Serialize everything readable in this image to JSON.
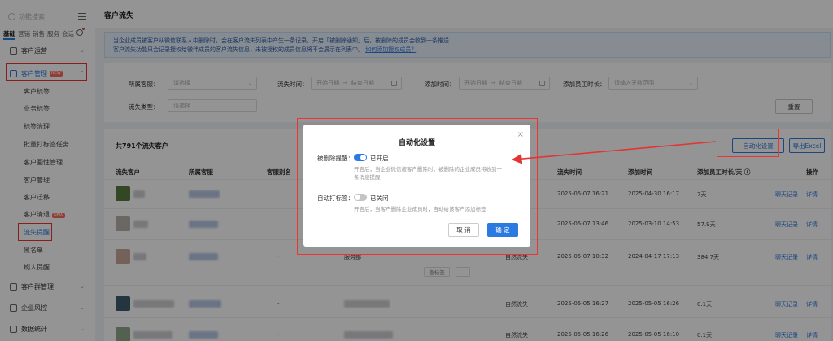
{
  "sidebar": {
    "search_placeholder": "功能搜索",
    "tabs": [
      "基础",
      "营销",
      "销售",
      "服务",
      "会话"
    ],
    "groups": [
      {
        "label": "客户运营"
      },
      {
        "label": "客户管理",
        "badge": "NEW"
      },
      {
        "label": "客户群管理"
      },
      {
        "label": "企业风控"
      },
      {
        "label": "数据统计"
      }
    ],
    "sub_items": [
      "客户标签",
      "业务标签",
      "标签治理",
      "批量打标签任务",
      "客户画性管理",
      "客户管理",
      "客户迁移",
      "客户清退",
      "流失提醒",
      "黑名单",
      "刷人提醒"
    ],
    "sub_badge": "NEW"
  },
  "page": {
    "title": "客户流失",
    "notice_line1": "当企业成员被客户从微信联系人中删除时，会在客户流失列表中产生一条记录。开启「被删除通知」后，被删除的成员会收到一条推送",
    "notice_line2": "客户流失功能只会记录授权给微伴成员的客户流失信息，未被授权的成员信息将不会展示在列表中。",
    "notice_link": "如何添加授权成员？"
  },
  "filters": {
    "owner_label": "所属客服：",
    "owner_placeholder": "请选择",
    "lost_time_label": "流失时间：",
    "lost_start": "开始日期",
    "lost_end": "结束日期",
    "add_time_label": "添加时间：",
    "add_start": "开始日期",
    "add_end": "结束日期",
    "duration_label": "添加员工时长：",
    "duration_placeholder": "请输入天数范围",
    "type_label": "流失类型：",
    "type_placeholder": "请选择",
    "reset": "重置",
    "arrow": "→"
  },
  "table": {
    "total": "共791个流失客户",
    "btn_auto": "自动化设置",
    "btn_export": "导出Excel",
    "headers": [
      "流失客户",
      "所属客服",
      "客服别名",
      "流失时间",
      "添加时间",
      "添加员工时长/天 ⓘ",
      "操作"
    ],
    "rows": [
      {
        "alias": "-",
        "lost": "2025-05-07 16:21",
        "added": "2025-04-30 16:17",
        "days": "7天",
        "op1": "聊天记录",
        "op2": "详情"
      },
      {
        "alias": "-",
        "lost": "2025-05-07 13:46",
        "added": "2025-03-10 14:53",
        "days": "57.9天",
        "op1": "聊天记录",
        "op2": "详情"
      },
      {
        "alias": "-",
        "dept": "服务部",
        "type": "自然流失",
        "lost": "2025-05-07 10:32",
        "added": "2024-04-17 17:13",
        "days": "384.7天",
        "op1": "聊天记录",
        "op2": "详情",
        "mini": "查标签",
        "more": "..."
      },
      {
        "alias": "-",
        "type": "自然流失",
        "lost": "2025-05-05 16:27",
        "added": "2025-05-05 16:26",
        "days": "0.1天",
        "op1": "聊天记录",
        "op2": "详情"
      },
      {
        "alias": "-",
        "type": "自然流失",
        "lost": "2025-05-05 16:26",
        "added": "2025-05-05 16:10",
        "days": "0.1天",
        "op1": "聊天记录",
        "op2": "详情"
      }
    ]
  },
  "modal": {
    "title": "自动化设置",
    "close": "×",
    "opt1_label": "被删除提醒：",
    "opt1_state": "已开启",
    "opt1_desc_l1": "开启后，当企业微信被客户删除时，被删除的企业成员将收到一",
    "opt1_desc_l2": "条消息提醒",
    "opt2_label": "自动打标签：",
    "opt2_state": "已关闭",
    "opt2_desc": "开启后，当客户删除企业成员时，自动给该客户添加标签",
    "cancel": "取 消",
    "confirm": "确 定"
  },
  "colors": {
    "accent": "#2a7ae2",
    "annotation": "#e33333"
  }
}
